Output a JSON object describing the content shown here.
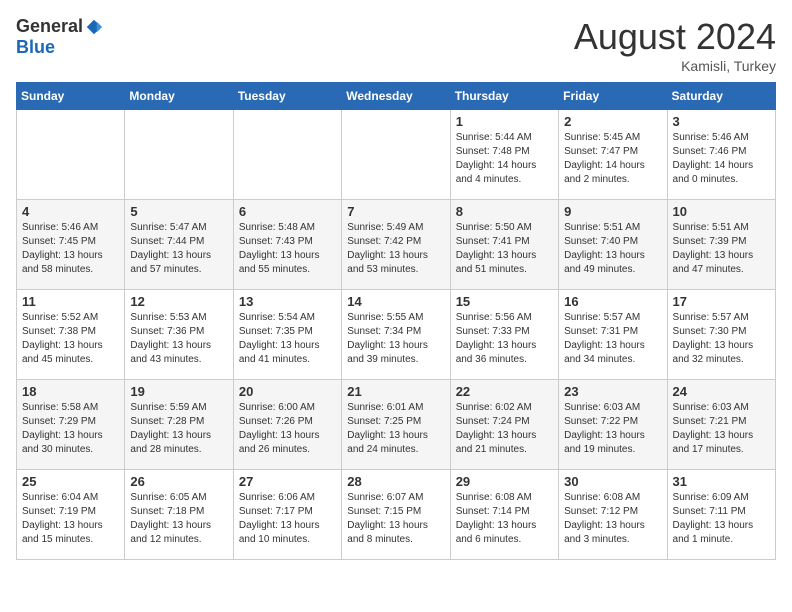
{
  "header": {
    "logo_general": "General",
    "logo_blue": "Blue",
    "month_title": "August 2024",
    "subtitle": "Kamisli, Turkey"
  },
  "weekdays": [
    "Sunday",
    "Monday",
    "Tuesday",
    "Wednesday",
    "Thursday",
    "Friday",
    "Saturday"
  ],
  "weeks": [
    [
      {
        "day": "",
        "info": ""
      },
      {
        "day": "",
        "info": ""
      },
      {
        "day": "",
        "info": ""
      },
      {
        "day": "",
        "info": ""
      },
      {
        "day": "1",
        "info": "Sunrise: 5:44 AM\nSunset: 7:48 PM\nDaylight: 14 hours\nand 4 minutes."
      },
      {
        "day": "2",
        "info": "Sunrise: 5:45 AM\nSunset: 7:47 PM\nDaylight: 14 hours\nand 2 minutes."
      },
      {
        "day": "3",
        "info": "Sunrise: 5:46 AM\nSunset: 7:46 PM\nDaylight: 14 hours\nand 0 minutes."
      }
    ],
    [
      {
        "day": "4",
        "info": "Sunrise: 5:46 AM\nSunset: 7:45 PM\nDaylight: 13 hours\nand 58 minutes."
      },
      {
        "day": "5",
        "info": "Sunrise: 5:47 AM\nSunset: 7:44 PM\nDaylight: 13 hours\nand 57 minutes."
      },
      {
        "day": "6",
        "info": "Sunrise: 5:48 AM\nSunset: 7:43 PM\nDaylight: 13 hours\nand 55 minutes."
      },
      {
        "day": "7",
        "info": "Sunrise: 5:49 AM\nSunset: 7:42 PM\nDaylight: 13 hours\nand 53 minutes."
      },
      {
        "day": "8",
        "info": "Sunrise: 5:50 AM\nSunset: 7:41 PM\nDaylight: 13 hours\nand 51 minutes."
      },
      {
        "day": "9",
        "info": "Sunrise: 5:51 AM\nSunset: 7:40 PM\nDaylight: 13 hours\nand 49 minutes."
      },
      {
        "day": "10",
        "info": "Sunrise: 5:51 AM\nSunset: 7:39 PM\nDaylight: 13 hours\nand 47 minutes."
      }
    ],
    [
      {
        "day": "11",
        "info": "Sunrise: 5:52 AM\nSunset: 7:38 PM\nDaylight: 13 hours\nand 45 minutes."
      },
      {
        "day": "12",
        "info": "Sunrise: 5:53 AM\nSunset: 7:36 PM\nDaylight: 13 hours\nand 43 minutes."
      },
      {
        "day": "13",
        "info": "Sunrise: 5:54 AM\nSunset: 7:35 PM\nDaylight: 13 hours\nand 41 minutes."
      },
      {
        "day": "14",
        "info": "Sunrise: 5:55 AM\nSunset: 7:34 PM\nDaylight: 13 hours\nand 39 minutes."
      },
      {
        "day": "15",
        "info": "Sunrise: 5:56 AM\nSunset: 7:33 PM\nDaylight: 13 hours\nand 36 minutes."
      },
      {
        "day": "16",
        "info": "Sunrise: 5:57 AM\nSunset: 7:31 PM\nDaylight: 13 hours\nand 34 minutes."
      },
      {
        "day": "17",
        "info": "Sunrise: 5:57 AM\nSunset: 7:30 PM\nDaylight: 13 hours\nand 32 minutes."
      }
    ],
    [
      {
        "day": "18",
        "info": "Sunrise: 5:58 AM\nSunset: 7:29 PM\nDaylight: 13 hours\nand 30 minutes."
      },
      {
        "day": "19",
        "info": "Sunrise: 5:59 AM\nSunset: 7:28 PM\nDaylight: 13 hours\nand 28 minutes."
      },
      {
        "day": "20",
        "info": "Sunrise: 6:00 AM\nSunset: 7:26 PM\nDaylight: 13 hours\nand 26 minutes."
      },
      {
        "day": "21",
        "info": "Sunrise: 6:01 AM\nSunset: 7:25 PM\nDaylight: 13 hours\nand 24 minutes."
      },
      {
        "day": "22",
        "info": "Sunrise: 6:02 AM\nSunset: 7:24 PM\nDaylight: 13 hours\nand 21 minutes."
      },
      {
        "day": "23",
        "info": "Sunrise: 6:03 AM\nSunset: 7:22 PM\nDaylight: 13 hours\nand 19 minutes."
      },
      {
        "day": "24",
        "info": "Sunrise: 6:03 AM\nSunset: 7:21 PM\nDaylight: 13 hours\nand 17 minutes."
      }
    ],
    [
      {
        "day": "25",
        "info": "Sunrise: 6:04 AM\nSunset: 7:19 PM\nDaylight: 13 hours\nand 15 minutes."
      },
      {
        "day": "26",
        "info": "Sunrise: 6:05 AM\nSunset: 7:18 PM\nDaylight: 13 hours\nand 12 minutes."
      },
      {
        "day": "27",
        "info": "Sunrise: 6:06 AM\nSunset: 7:17 PM\nDaylight: 13 hours\nand 10 minutes."
      },
      {
        "day": "28",
        "info": "Sunrise: 6:07 AM\nSunset: 7:15 PM\nDaylight: 13 hours\nand 8 minutes."
      },
      {
        "day": "29",
        "info": "Sunrise: 6:08 AM\nSunset: 7:14 PM\nDaylight: 13 hours\nand 6 minutes."
      },
      {
        "day": "30",
        "info": "Sunrise: 6:08 AM\nSunset: 7:12 PM\nDaylight: 13 hours\nand 3 minutes."
      },
      {
        "day": "31",
        "info": "Sunrise: 6:09 AM\nSunset: 7:11 PM\nDaylight: 13 hours\nand 1 minute."
      }
    ]
  ]
}
